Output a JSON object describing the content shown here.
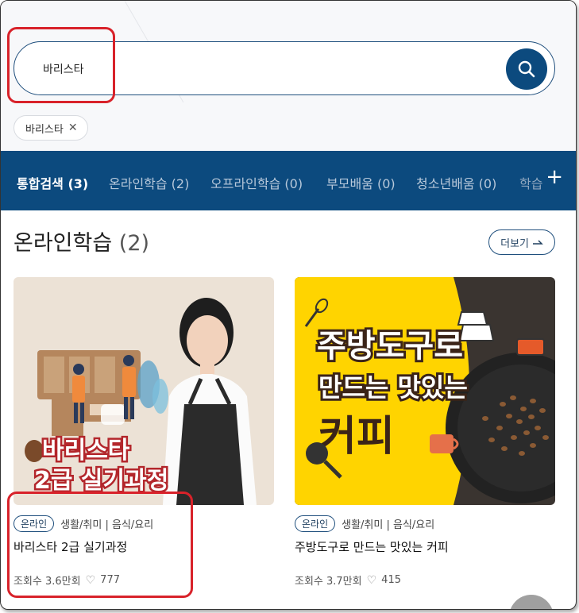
{
  "search": {
    "value": "바리스타",
    "placeholder": ""
  },
  "chips": [
    {
      "label": "바리스타"
    }
  ],
  "tabs": [
    {
      "label": "통합검색 (3)"
    },
    {
      "label": "온라인학습 (2)"
    },
    {
      "label": "오프라인학습 (0)"
    },
    {
      "label": "부모배움 (0)"
    },
    {
      "label": "청소년배움 (0)"
    },
    {
      "label": "학습"
    }
  ],
  "section": {
    "title": "온라인학습",
    "count": "(2)",
    "more_label": "더보기"
  },
  "cards": [
    {
      "badge": "온라인",
      "category": "생활/취미 | 음식/요리",
      "title": "바리스타 2급 실기과정",
      "views": "조회수 3.6만회",
      "likes": "777",
      "thumb_line1": "바리스타",
      "thumb_line2": "2급 실기과정"
    },
    {
      "badge": "온라인",
      "category": "생활/취미 | 음식/요리",
      "title": "주방도구로 만드는 맛있는 커피",
      "views": "조회수 3.7만회",
      "likes": "415",
      "thumb_line1": "주방도구로",
      "thumb_line2": "만드는 맛있는",
      "thumb_line3": "커피"
    }
  ],
  "colors": {
    "brand": "#0c4a7e",
    "annotation": "#d8222a",
    "thumb2_bg": "#ffd400"
  },
  "icons": {
    "search": "search-icon",
    "close": "close-icon",
    "plus": "plus-icon",
    "heart": "heart-icon",
    "more": "arrow-right-icon"
  }
}
